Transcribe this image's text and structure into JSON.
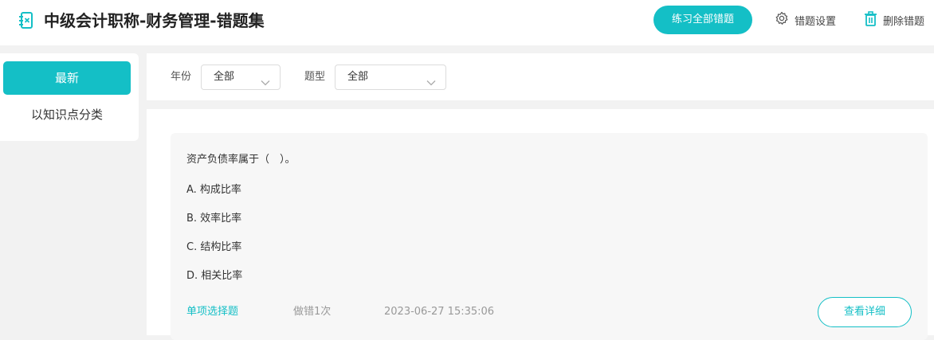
{
  "header": {
    "title": "中级会计职称-财务管理-错题集",
    "practice_all_label": "练习全部错题",
    "settings_label": "错题设置",
    "delete_label": "删除错题"
  },
  "sidebar": {
    "items": [
      {
        "label": "最新",
        "active": true
      },
      {
        "label": "以知识点分类",
        "active": false
      }
    ]
  },
  "filters": {
    "year_label": "年份",
    "year_value": "全部",
    "type_label": "题型",
    "type_value": "全部"
  },
  "question": {
    "stem": "资产负债率属于（　）。",
    "options": [
      "A. 构成比率",
      "B. 效率比率",
      "C. 结构比率",
      "D. 相关比率"
    ],
    "type": "单项选择题",
    "wrong_count": "做错1次",
    "timestamp": "2023-06-27 15:35:06",
    "detail_label": "查看详细"
  },
  "colors": {
    "accent": "#14bfc6",
    "background": "#f2f2f2"
  }
}
